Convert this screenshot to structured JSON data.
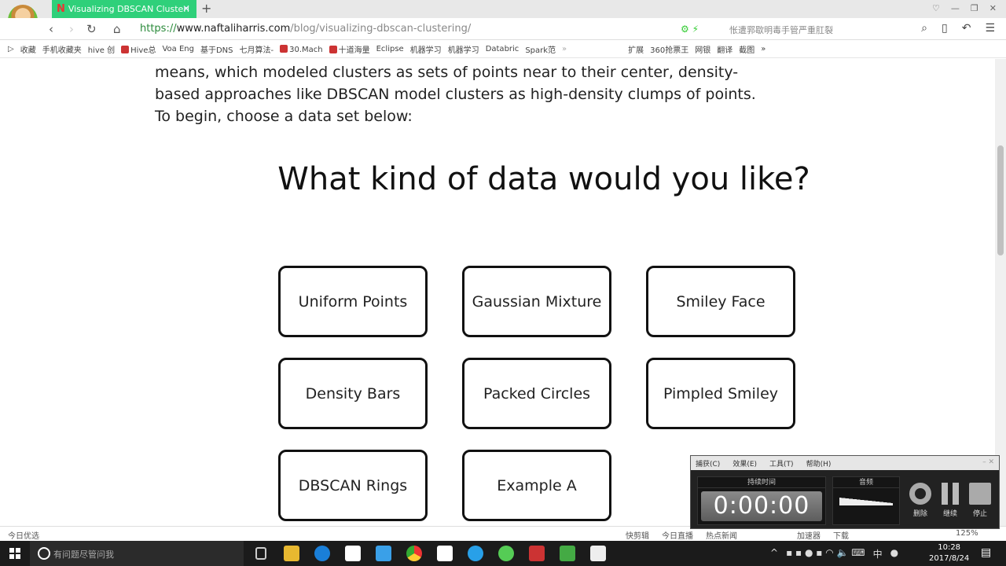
{
  "browser": {
    "tab_title": "Visualizing DBSCAN Clusteri",
    "new_tab": "+",
    "url_scheme": "https://",
    "url_domain": "www.naftaliharris.com",
    "url_path": "/blog/visualizing-dbscan-clustering/",
    "search_hint": "怅遭郛歇明毒手管严重肛裂",
    "bookmarks": [
      "收藏",
      "手机收藏夹",
      "hive 创",
      "Hive总",
      "Voa Eng",
      "基于DNS",
      "七月算法-",
      "30.Mach",
      "十道海量",
      "Eclipse",
      "机器学习",
      "机器学习",
      "Databric",
      "Spark范",
      "»"
    ],
    "bookmarks_right": [
      "扩展",
      "360抢票王",
      "网银",
      "翻译",
      "截图",
      "»"
    ]
  },
  "page": {
    "intro": "means, which modeled clusters as sets of points near to their center, density-based approaches like DBSCAN model clusters as high-density clumps of points. To begin, choose a data set below:",
    "heading": "What kind of data would you like?",
    "datasets": [
      "Uniform Points",
      "Gaussian Mixture",
      "Smiley Face",
      "Density Bars",
      "Packed Circles",
      "Pimpled Smiley",
      "DBSCAN Rings",
      "Example A"
    ]
  },
  "statusbar": {
    "left": "今日优选",
    "right": [
      "快剪辑",
      "今日直播",
      "热点新闻",
      "加速器",
      "下载",
      "125%"
    ]
  },
  "recorder": {
    "menu": [
      "捕获(C)",
      "效果(E)",
      "工具(T)",
      "帮助(H)"
    ],
    "duration_label": "持续时间",
    "time": "0:00:00",
    "audio_label": "音频",
    "delete": "删除",
    "resume": "继续",
    "stop": "停止"
  },
  "taskbar": {
    "search_placeholder": "有问题尽管问我",
    "time": "10:28",
    "date": "2017/8/24",
    "ime": "中"
  }
}
